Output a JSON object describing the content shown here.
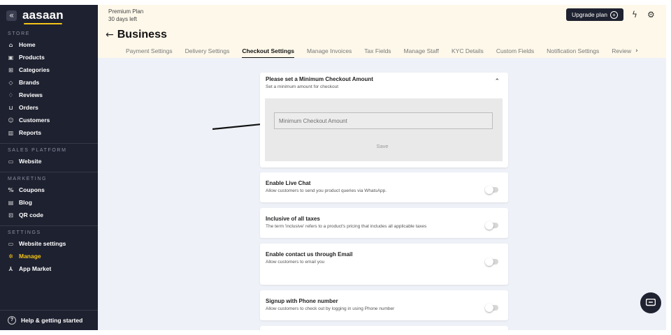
{
  "sidebar": {
    "collapse_icon": "«",
    "brand": "aasaan",
    "sections": {
      "store": "STORE",
      "sales": "SALES PLATFORM",
      "marketing": "MARKETING",
      "settings": "SETTINGS"
    },
    "store_items": [
      {
        "label": "Home",
        "icon": "home-icon"
      },
      {
        "label": "Products",
        "icon": "box-icon"
      },
      {
        "label": "Categories",
        "icon": "grid-icon"
      },
      {
        "label": "Brands",
        "icon": "tag-icon"
      },
      {
        "label": "Reviews",
        "icon": "thumbs-up-icon"
      },
      {
        "label": "Orders",
        "icon": "cart-icon"
      },
      {
        "label": "Customers",
        "icon": "users-icon"
      },
      {
        "label": "Reports",
        "icon": "bar-chart-icon"
      }
    ],
    "sales_items": [
      {
        "label": "Website",
        "icon": "monitor-icon"
      }
    ],
    "marketing_items": [
      {
        "label": "Coupons",
        "icon": "percent-icon"
      },
      {
        "label": "Blog",
        "icon": "document-icon"
      },
      {
        "label": "QR code",
        "icon": "qr-icon"
      }
    ],
    "settings_items": [
      {
        "label": "Website settings",
        "icon": "browser-settings-icon"
      },
      {
        "label": "Manage",
        "icon": "gear-icon",
        "active": true
      },
      {
        "label": "App Market",
        "icon": "apps-icon"
      }
    ],
    "help": "Help & getting started"
  },
  "header": {
    "plan_name": "Premium Plan",
    "plan_days": "30 days left",
    "title": "Business",
    "upgrade_label": "Upgrade plan",
    "tabs": [
      "Payment Settings",
      "Delivery Settings",
      "Checkout Settings",
      "Manage Invoices",
      "Tax Fields",
      "Manage Staff",
      "KYC Details",
      "Custom Fields",
      "Notification Settings",
      "Review"
    ],
    "active_tab": "Checkout Settings"
  },
  "settings": {
    "min_checkout": {
      "title": "Please set a Minimum Checkout Amount",
      "description": "Set a minimum amount for checkout",
      "input_placeholder": "Minimum Checkout Amount",
      "input_value": "",
      "save_label": "Save",
      "expanded": true
    },
    "toggles": [
      {
        "title": "Enable Live Chat",
        "description": "Allow customers to send you product queries via WhatsApp.",
        "enabled": false
      },
      {
        "title": "Inclusive of all taxes",
        "description": "The term 'inclusive' refers to a product's pricing that includes all applicable taxes",
        "enabled": false
      },
      {
        "title": "Enable contact us through Email",
        "description": "Allow customers to email you",
        "enabled": false
      },
      {
        "title": "Signup with Phone number",
        "description": "Allow customers to check out by logging in using Phone number",
        "enabled": false
      }
    ]
  },
  "colors": {
    "sidebar_bg": "#1e2130",
    "accent": "#f5c518",
    "header_bg": "#fdf8ea",
    "main_bg": "#eef1f7"
  }
}
